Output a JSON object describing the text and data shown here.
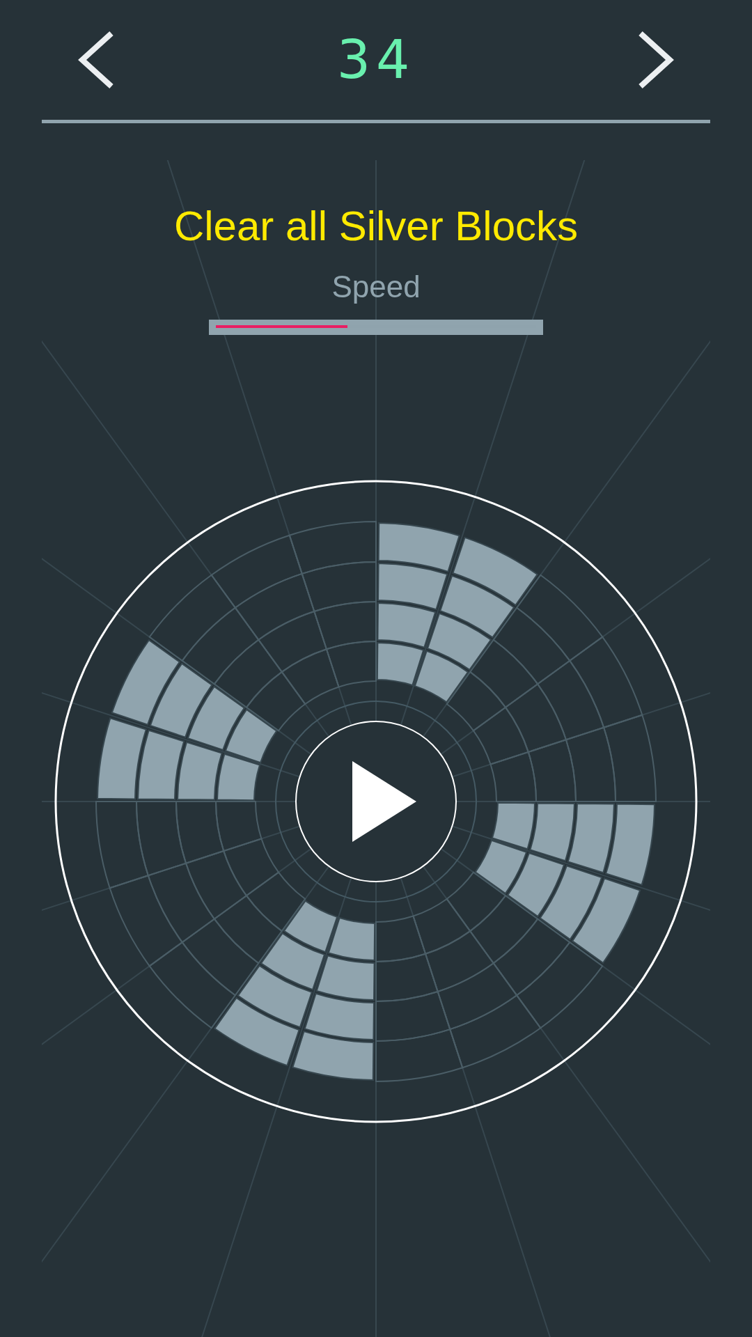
{
  "header": {
    "level_number": "34"
  },
  "goal": {
    "title": "Clear all Silver Blocks"
  },
  "speed": {
    "label": "Speed",
    "level": 0.41
  },
  "board": {
    "sectors": [
      {
        "rings": [
          {
            "filled": false
          },
          {
            "filled": false
          },
          {
            "filled": false
          },
          {
            "filled": false
          }
        ]
      },
      {
        "rings": [
          {
            "filled": false
          },
          {
            "filled": false
          },
          {
            "filled": false
          },
          {
            "filled": false
          }
        ]
      },
      {
        "rings": [
          {
            "filled": false
          },
          {
            "filled": false
          },
          {
            "filled": false
          },
          {
            "filled": false
          }
        ]
      },
      {
        "rings": [
          {
            "filled": true
          },
          {
            "filled": true
          },
          {
            "filled": true
          },
          {
            "filled": true
          }
        ]
      },
      {
        "rings": [
          {
            "filled": true
          },
          {
            "filled": true
          },
          {
            "filled": true
          },
          {
            "filled": true
          }
        ]
      },
      {
        "rings": [
          {
            "filled": false
          },
          {
            "filled": false
          },
          {
            "filled": false
          },
          {
            "filled": false
          }
        ]
      },
      {
        "rings": [
          {
            "filled": false
          },
          {
            "filled": false
          },
          {
            "filled": false
          },
          {
            "filled": false
          }
        ]
      },
      {
        "rings": [
          {
            "filled": false
          },
          {
            "filled": false
          },
          {
            "filled": false
          },
          {
            "filled": false
          }
        ]
      },
      {
        "rings": [
          {
            "filled": true
          },
          {
            "filled": true
          },
          {
            "filled": true
          },
          {
            "filled": true
          }
        ]
      },
      {
        "rings": [
          {
            "filled": true
          },
          {
            "filled": true
          },
          {
            "filled": true
          },
          {
            "filled": true
          }
        ]
      },
      {
        "rings": [
          {
            "filled": false
          },
          {
            "filled": false
          },
          {
            "filled": false
          },
          {
            "filled": false
          }
        ]
      },
      {
        "rings": [
          {
            "filled": false
          },
          {
            "filled": false
          },
          {
            "filled": false
          },
          {
            "filled": false
          }
        ]
      },
      {
        "rings": [
          {
            "filled": false
          },
          {
            "filled": false
          },
          {
            "filled": false
          },
          {
            "filled": false
          }
        ]
      },
      {
        "rings": [
          {
            "filled": true
          },
          {
            "filled": true
          },
          {
            "filled": true
          },
          {
            "filled": true
          }
        ]
      },
      {
        "rings": [
          {
            "filled": true
          },
          {
            "filled": true
          },
          {
            "filled": true
          },
          {
            "filled": true
          }
        ]
      },
      {
        "rings": [
          {
            "filled": false
          },
          {
            "filled": false
          },
          {
            "filled": false
          },
          {
            "filled": false
          }
        ]
      },
      {
        "rings": [
          {
            "filled": false
          },
          {
            "filled": false
          },
          {
            "filled": false
          },
          {
            "filled": false
          }
        ]
      },
      {
        "rings": [
          {
            "filled": false
          },
          {
            "filled": false
          },
          {
            "filled": false
          },
          {
            "filled": false
          }
        ]
      },
      {
        "rings": [
          {
            "filled": true
          },
          {
            "filled": true
          },
          {
            "filled": true
          },
          {
            "filled": true
          }
        ]
      },
      {
        "rings": [
          {
            "filled": true
          },
          {
            "filled": true
          },
          {
            "filled": true
          },
          {
            "filled": true
          }
        ]
      }
    ]
  }
}
